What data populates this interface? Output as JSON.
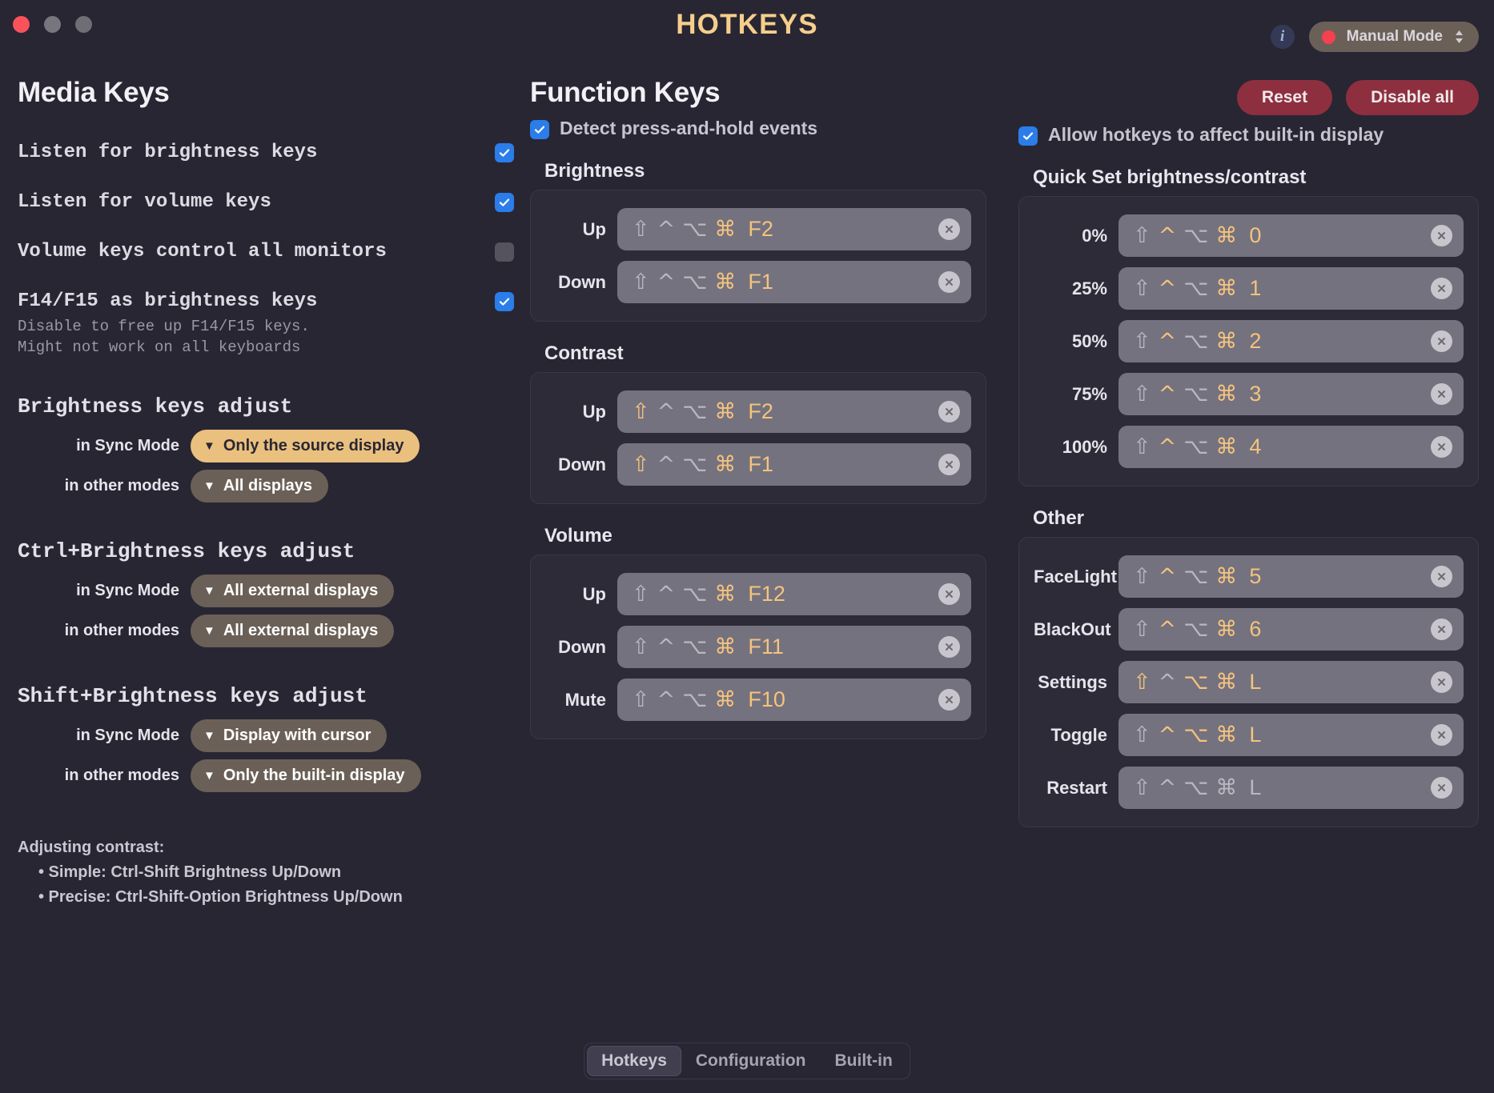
{
  "window": {
    "title": "HOTKEYS",
    "traffic_lights": [
      "close",
      "minimize",
      "zoom"
    ]
  },
  "topbar": {
    "info_icon": "info-icon",
    "mode": {
      "label": "Manual Mode",
      "dot_color": "#f5414f",
      "chevrons": "chevron-updown-icon"
    }
  },
  "media_keys": {
    "title": "Media Keys",
    "rows": [
      {
        "label": "Listen for brightness keys",
        "sub": "",
        "checked": true
      },
      {
        "label": "Listen for volume keys",
        "sub": "",
        "checked": true
      },
      {
        "label": "Volume keys control all monitors",
        "sub": "",
        "checked": false
      },
      {
        "label": "F14/F15 as brightness keys",
        "sub": "Disable to free up F14/F15 keys.\nMight not work on all keyboards",
        "checked": true
      }
    ],
    "adjust_groups": [
      {
        "title": "Brightness keys adjust",
        "rows": [
          {
            "key": "in Sync Mode",
            "value": "Only the source display",
            "highlight": true
          },
          {
            "key": "in other modes",
            "value": "All displays",
            "highlight": false
          }
        ]
      },
      {
        "title": "Ctrl+Brightness keys adjust",
        "rows": [
          {
            "key": "in Sync Mode",
            "value": "All external displays",
            "highlight": false
          },
          {
            "key": "in other modes",
            "value": "All external displays",
            "highlight": false
          }
        ]
      },
      {
        "title": "Shift+Brightness keys adjust",
        "rows": [
          {
            "key": "in Sync Mode",
            "value": "Display with cursor",
            "highlight": false
          },
          {
            "key": "in other modes",
            "value": "Only the built-in display",
            "highlight": false
          }
        ]
      }
    ],
    "hints": {
      "heading": "Adjusting contrast:",
      "line1": "• Simple:  Ctrl-Shift Brightness Up/Down",
      "line2": "• Precise: Ctrl-Shift-Option Brightness Up/Down"
    }
  },
  "function_keys": {
    "title": "Function Keys",
    "detect_hold": {
      "label": "Detect press-and-hold events",
      "checked": true
    },
    "sections": [
      {
        "title": "Brightness",
        "rows": [
          {
            "label": "Up",
            "shift": false,
            "control": false,
            "option": false,
            "command": true,
            "key": "F2"
          },
          {
            "label": "Down",
            "shift": false,
            "control": false,
            "option": false,
            "command": true,
            "key": "F1"
          }
        ]
      },
      {
        "title": "Contrast",
        "rows": [
          {
            "label": "Up",
            "shift": true,
            "control": false,
            "option": false,
            "command": true,
            "key": "F2"
          },
          {
            "label": "Down",
            "shift": true,
            "control": false,
            "option": false,
            "command": true,
            "key": "F1"
          }
        ]
      },
      {
        "title": "Volume",
        "rows": [
          {
            "label": "Up",
            "shift": false,
            "control": false,
            "option": false,
            "command": true,
            "key": "F12"
          },
          {
            "label": "Down",
            "shift": false,
            "control": false,
            "option": false,
            "command": true,
            "key": "F11"
          },
          {
            "label": "Mute",
            "shift": false,
            "control": false,
            "option": false,
            "command": true,
            "key": "F10"
          }
        ]
      }
    ]
  },
  "right_panel": {
    "buttons": {
      "reset": "Reset",
      "disable_all": "Disable all"
    },
    "allow_builtin": {
      "label": "Allow hotkeys to affect built-in display",
      "checked": true
    },
    "sections": [
      {
        "title": "Quick Set brightness/contrast",
        "rows": [
          {
            "label": "0%",
            "shift": false,
            "control": true,
            "option": false,
            "command": true,
            "key": "0"
          },
          {
            "label": "25%",
            "shift": false,
            "control": true,
            "option": false,
            "command": true,
            "key": "1"
          },
          {
            "label": "50%",
            "shift": false,
            "control": true,
            "option": false,
            "command": true,
            "key": "2"
          },
          {
            "label": "75%",
            "shift": false,
            "control": true,
            "option": false,
            "command": true,
            "key": "3"
          },
          {
            "label": "100%",
            "shift": false,
            "control": true,
            "option": false,
            "command": true,
            "key": "4"
          }
        ]
      },
      {
        "title": "Other",
        "rows": [
          {
            "label": "FaceLight",
            "shift": false,
            "control": true,
            "option": false,
            "command": true,
            "key": "5"
          },
          {
            "label": "BlackOut",
            "shift": false,
            "control": true,
            "option": false,
            "command": true,
            "key": "6"
          },
          {
            "label": "Settings",
            "shift": true,
            "control": false,
            "option": true,
            "command": true,
            "key": "L"
          },
          {
            "label": "Toggle",
            "shift": false,
            "control": true,
            "option": true,
            "command": true,
            "key": "L"
          },
          {
            "label": "Restart",
            "shift": false,
            "control": false,
            "option": false,
            "command": false,
            "key": "L"
          }
        ]
      }
    ]
  },
  "tabs": [
    {
      "label": "Hotkeys",
      "active": true
    },
    {
      "label": "Configuration",
      "active": false
    },
    {
      "label": "Built-in",
      "active": false
    }
  ],
  "glyphs": {
    "shift": "⇧",
    "control": "^",
    "option": "⌥",
    "command": "⌘"
  },
  "colors": {
    "background": "#282633",
    "accent_gold": "#f4c37e",
    "title_gold": "#f6ce8c",
    "checkbox_on": "#2b7de9",
    "danger": "#8e2f3f",
    "dropdown_plain": "#6b6057",
    "dropdown_highlight": "#eac07e",
    "recorder_bg": "#74727e"
  }
}
